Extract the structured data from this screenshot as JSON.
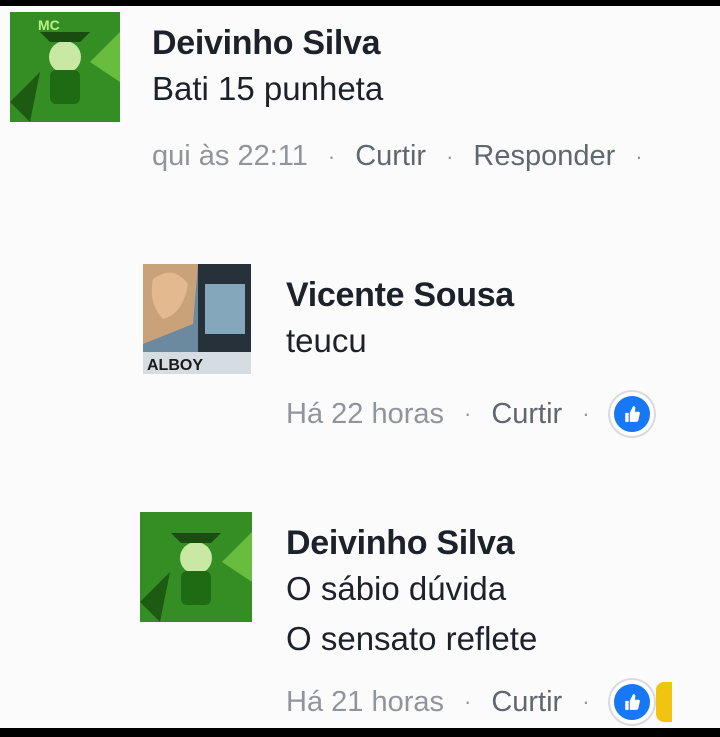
{
  "comments": [
    {
      "author": "Deivinho Silva",
      "lines": [
        "Bati 15 punheta"
      ],
      "time": "qui às 22:11",
      "like_action": "Curtir",
      "reply_action": "Responder",
      "has_reaction": false
    },
    {
      "author": "Vicente Sousa",
      "lines": [
        "teucu"
      ],
      "time": "Há 22 horas",
      "like_action": "Curtir",
      "has_reaction": true
    },
    {
      "author": "Deivinho Silva",
      "lines": [
        "O sábio dúvida",
        "O sensato reflete"
      ],
      "time": "Há 21 horas",
      "like_action": "Curtir",
      "has_reaction": true
    }
  ],
  "separator": "·",
  "icons": {
    "reaction": "thumbs-up-icon",
    "secondary_reaction": "smile-reaction-icon"
  },
  "colors": {
    "name": "#1d2129",
    "meta": "#90949c",
    "like_blue": "#1877f2",
    "avatar_green": "#2f8f1f"
  }
}
